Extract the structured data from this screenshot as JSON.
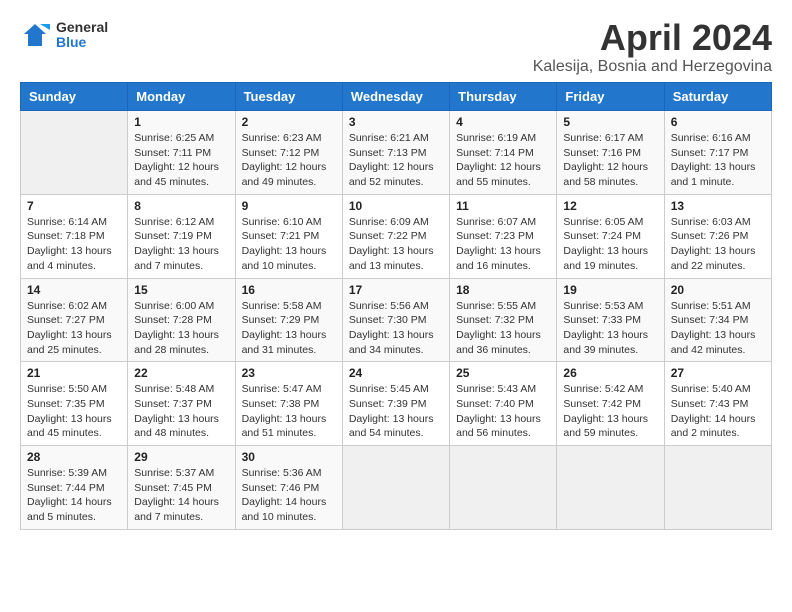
{
  "logo": {
    "general": "General",
    "blue": "Blue"
  },
  "title": {
    "month": "April 2024",
    "location": "Kalesija, Bosnia and Herzegovina"
  },
  "headers": [
    "Sunday",
    "Monday",
    "Tuesday",
    "Wednesday",
    "Thursday",
    "Friday",
    "Saturday"
  ],
  "weeks": [
    [
      {
        "day": "",
        "info": ""
      },
      {
        "day": "1",
        "info": "Sunrise: 6:25 AM\nSunset: 7:11 PM\nDaylight: 12 hours\nand 45 minutes."
      },
      {
        "day": "2",
        "info": "Sunrise: 6:23 AM\nSunset: 7:12 PM\nDaylight: 12 hours\nand 49 minutes."
      },
      {
        "day": "3",
        "info": "Sunrise: 6:21 AM\nSunset: 7:13 PM\nDaylight: 12 hours\nand 52 minutes."
      },
      {
        "day": "4",
        "info": "Sunrise: 6:19 AM\nSunset: 7:14 PM\nDaylight: 12 hours\nand 55 minutes."
      },
      {
        "day": "5",
        "info": "Sunrise: 6:17 AM\nSunset: 7:16 PM\nDaylight: 12 hours\nand 58 minutes."
      },
      {
        "day": "6",
        "info": "Sunrise: 6:16 AM\nSunset: 7:17 PM\nDaylight: 13 hours\nand 1 minute."
      }
    ],
    [
      {
        "day": "7",
        "info": "Sunrise: 6:14 AM\nSunset: 7:18 PM\nDaylight: 13 hours\nand 4 minutes."
      },
      {
        "day": "8",
        "info": "Sunrise: 6:12 AM\nSunset: 7:19 PM\nDaylight: 13 hours\nand 7 minutes."
      },
      {
        "day": "9",
        "info": "Sunrise: 6:10 AM\nSunset: 7:21 PM\nDaylight: 13 hours\nand 10 minutes."
      },
      {
        "day": "10",
        "info": "Sunrise: 6:09 AM\nSunset: 7:22 PM\nDaylight: 13 hours\nand 13 minutes."
      },
      {
        "day": "11",
        "info": "Sunrise: 6:07 AM\nSunset: 7:23 PM\nDaylight: 13 hours\nand 16 minutes."
      },
      {
        "day": "12",
        "info": "Sunrise: 6:05 AM\nSunset: 7:24 PM\nDaylight: 13 hours\nand 19 minutes."
      },
      {
        "day": "13",
        "info": "Sunrise: 6:03 AM\nSunset: 7:26 PM\nDaylight: 13 hours\nand 22 minutes."
      }
    ],
    [
      {
        "day": "14",
        "info": "Sunrise: 6:02 AM\nSunset: 7:27 PM\nDaylight: 13 hours\nand 25 minutes."
      },
      {
        "day": "15",
        "info": "Sunrise: 6:00 AM\nSunset: 7:28 PM\nDaylight: 13 hours\nand 28 minutes."
      },
      {
        "day": "16",
        "info": "Sunrise: 5:58 AM\nSunset: 7:29 PM\nDaylight: 13 hours\nand 31 minutes."
      },
      {
        "day": "17",
        "info": "Sunrise: 5:56 AM\nSunset: 7:30 PM\nDaylight: 13 hours\nand 34 minutes."
      },
      {
        "day": "18",
        "info": "Sunrise: 5:55 AM\nSunset: 7:32 PM\nDaylight: 13 hours\nand 36 minutes."
      },
      {
        "day": "19",
        "info": "Sunrise: 5:53 AM\nSunset: 7:33 PM\nDaylight: 13 hours\nand 39 minutes."
      },
      {
        "day": "20",
        "info": "Sunrise: 5:51 AM\nSunset: 7:34 PM\nDaylight: 13 hours\nand 42 minutes."
      }
    ],
    [
      {
        "day": "21",
        "info": "Sunrise: 5:50 AM\nSunset: 7:35 PM\nDaylight: 13 hours\nand 45 minutes."
      },
      {
        "day": "22",
        "info": "Sunrise: 5:48 AM\nSunset: 7:37 PM\nDaylight: 13 hours\nand 48 minutes."
      },
      {
        "day": "23",
        "info": "Sunrise: 5:47 AM\nSunset: 7:38 PM\nDaylight: 13 hours\nand 51 minutes."
      },
      {
        "day": "24",
        "info": "Sunrise: 5:45 AM\nSunset: 7:39 PM\nDaylight: 13 hours\nand 54 minutes."
      },
      {
        "day": "25",
        "info": "Sunrise: 5:43 AM\nSunset: 7:40 PM\nDaylight: 13 hours\nand 56 minutes."
      },
      {
        "day": "26",
        "info": "Sunrise: 5:42 AM\nSunset: 7:42 PM\nDaylight: 13 hours\nand 59 minutes."
      },
      {
        "day": "27",
        "info": "Sunrise: 5:40 AM\nSunset: 7:43 PM\nDaylight: 14 hours\nand 2 minutes."
      }
    ],
    [
      {
        "day": "28",
        "info": "Sunrise: 5:39 AM\nSunset: 7:44 PM\nDaylight: 14 hours\nand 5 minutes."
      },
      {
        "day": "29",
        "info": "Sunrise: 5:37 AM\nSunset: 7:45 PM\nDaylight: 14 hours\nand 7 minutes."
      },
      {
        "day": "30",
        "info": "Sunrise: 5:36 AM\nSunset: 7:46 PM\nDaylight: 14 hours\nand 10 minutes."
      },
      {
        "day": "",
        "info": ""
      },
      {
        "day": "",
        "info": ""
      },
      {
        "day": "",
        "info": ""
      },
      {
        "day": "",
        "info": ""
      }
    ]
  ]
}
